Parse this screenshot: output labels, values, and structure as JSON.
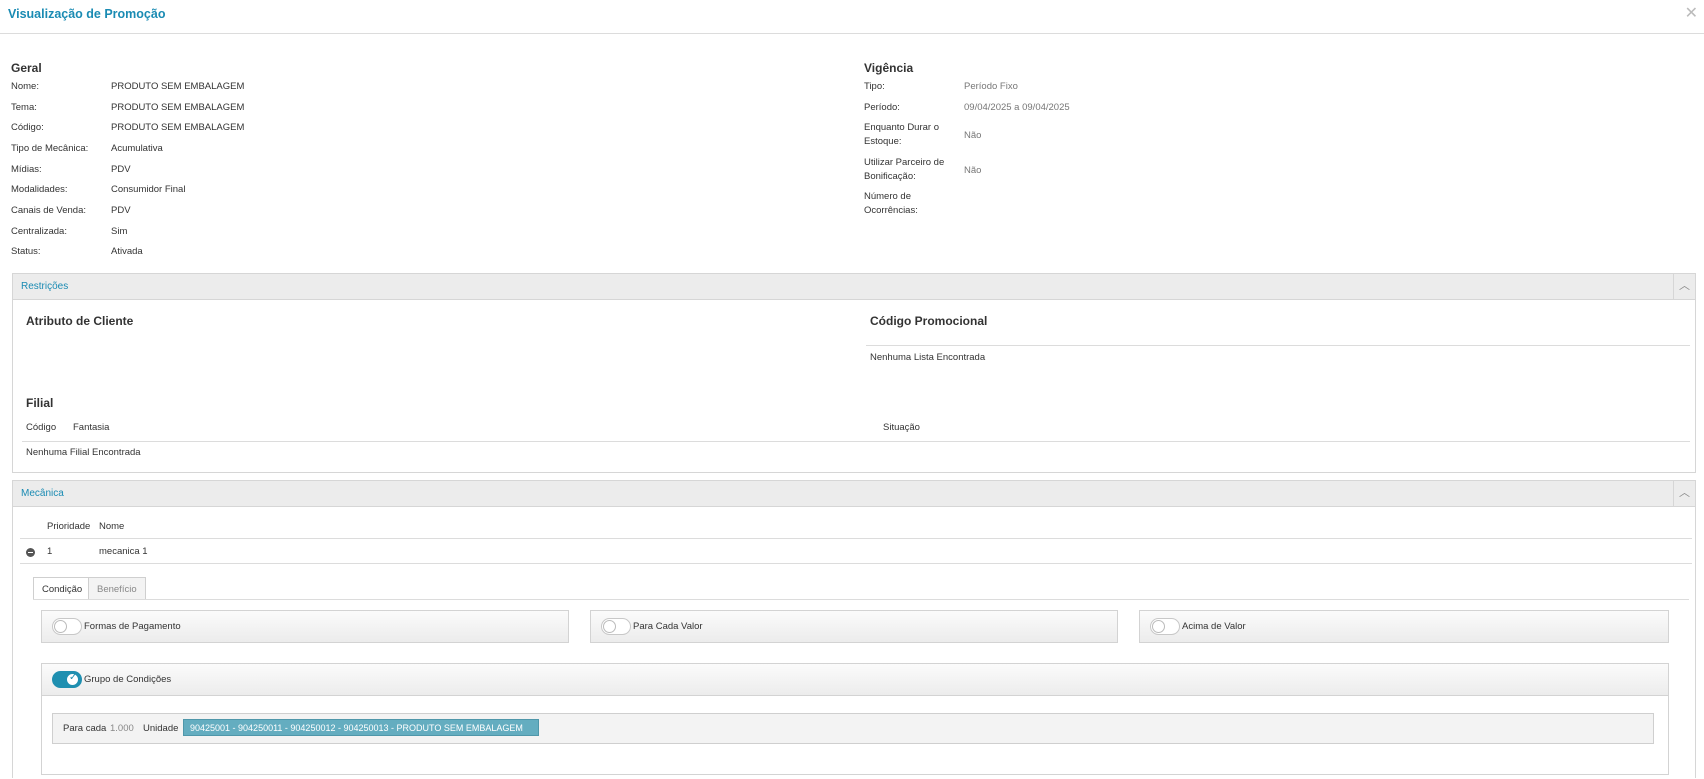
{
  "header": {
    "title": "Visualização de Promoção"
  },
  "geral": {
    "title": "Geral",
    "rows": [
      {
        "label": "Nome:",
        "value": "PRODUTO SEM EMBALAGEM"
      },
      {
        "label": "Tema:",
        "value": "PRODUTO SEM EMBALAGEM"
      },
      {
        "label": "Código:",
        "value": "PRODUTO SEM EMBALAGEM"
      },
      {
        "label": "Tipo de Mecânica:",
        "value": "Acumulativa"
      },
      {
        "label": "Mídias:",
        "value": "PDV"
      },
      {
        "label": "Modalidades:",
        "value": "Consumidor Final"
      },
      {
        "label": "Canais de Venda:",
        "value": "PDV"
      },
      {
        "label": "Centralizada:",
        "value": "Sim"
      },
      {
        "label": "Status:",
        "value": "Ativada"
      }
    ]
  },
  "vigencia": {
    "title": "Vigência",
    "tipo_label": "Tipo:",
    "tipo_value": "Período Fixo",
    "periodo_label": "Período:",
    "periodo_value": "09/04/2025 a 09/04/2025",
    "estoque_label_1": "Enquanto Durar o",
    "estoque_label_2": "Estoque:",
    "estoque_value": "Não",
    "parceiro_label_1": "Utilizar Parceiro de",
    "parceiro_label_2": "Bonificação:",
    "parceiro_value": "Não",
    "ocorrencias_label_1": "Número de",
    "ocorrencias_label_2": "Ocorrências:"
  },
  "restricoes": {
    "title": "Restrições",
    "atributo_title": "Atributo de Cliente",
    "codigo_promocional_title": "Código Promocional",
    "codigo_promocional_empty": "Nenhuma Lista Encontrada",
    "filial_title": "Filial",
    "filial_columns": [
      "Código",
      "Fantasia",
      "Situação"
    ],
    "filial_empty": "Nenhuma Filial Encontrada"
  },
  "mecanica": {
    "title": "Mecânica",
    "columns": [
      "Prioridade",
      "Nome"
    ],
    "row": {
      "prioridade": "1",
      "nome": "mecanica 1"
    },
    "tabs": [
      "Condição",
      "Benefício"
    ],
    "options": [
      {
        "label": "Formas de Pagamento",
        "on": false
      },
      {
        "label": "Para Cada Valor",
        "on": false
      },
      {
        "label": "Acima de Valor",
        "on": false
      }
    ],
    "grupo": {
      "label": "Grupo de Condições",
      "on": true,
      "para_cada_label": "Para cada",
      "para_cada_value": "1.000",
      "unidade_label": "Unidade",
      "chip": "90425001 - 904250011 - 904250012 - 904250013 - PRODUTO SEM EMBALAGEM"
    }
  },
  "colors": {
    "accent": "#1a8bb3",
    "toggle_on": "#1f8fb0",
    "chip": "#64adc0"
  }
}
